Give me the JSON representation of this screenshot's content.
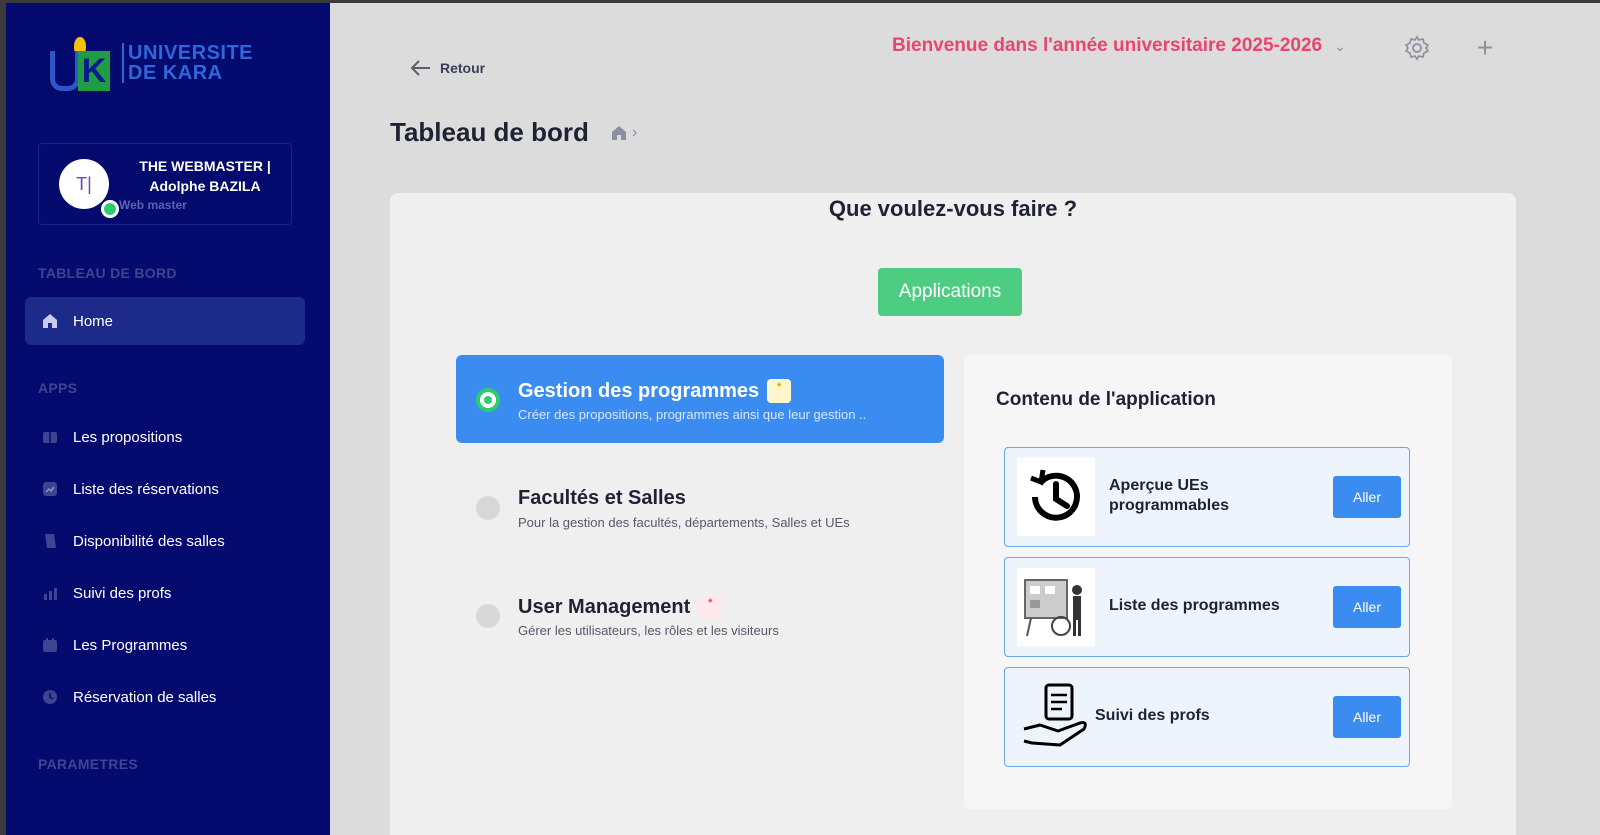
{
  "logo": {
    "letters_u": "U",
    "letters_k": "K",
    "line1": "UNIVERSITE",
    "line2": "DE KARA"
  },
  "profile": {
    "initials": "T|",
    "name": "THE WEBMASTER | Adolphe BAZILA",
    "role": "Web master"
  },
  "sidebar": {
    "section_dashboard": "TABLEAU DE BORD",
    "home": "Home",
    "section_apps": "APPS",
    "items": [
      {
        "label": "Les propositions",
        "icon": "book-icon"
      },
      {
        "label": "Liste des réservations",
        "icon": "chart-icon"
      },
      {
        "label": "Disponibilité des salles",
        "icon": "scroll-icon"
      },
      {
        "label": "Suivi des profs",
        "icon": "stats-icon"
      },
      {
        "label": "Les Programmes",
        "icon": "calendar-icon"
      },
      {
        "label": "Réservation de salles",
        "icon": "clock-icon"
      }
    ],
    "section_params": "PARAMETRES"
  },
  "header": {
    "back": "Retour",
    "welcome": "Bienvenue dans l'année universitaire 2025-2026",
    "page_title": "Tableau de bord"
  },
  "main": {
    "question": "Que voulez-vous faire ?",
    "apps_button": "Applications",
    "options": [
      {
        "title": "Gestion des programmes",
        "desc": "Créer des propositions, programmes ainsi que leur gestion ..",
        "badge": "*"
      },
      {
        "title": "Facultés et Salles",
        "desc": "Pour la gestion des facultés, départements, Salles et UEs"
      },
      {
        "title": "User Management",
        "desc": "Gérer les utilisateurs, les rôles et les visiteurs",
        "badge": "*"
      }
    ],
    "content_title": "Contenu de l'application",
    "content_items": [
      {
        "name": "Aperçue UEs programmables",
        "button": "Aller"
      },
      {
        "name": "Liste des programmes",
        "button": "Aller"
      },
      {
        "name": "Suivi des profs",
        "button": "Aller"
      }
    ]
  },
  "colors": {
    "sidebar": "#050a6e",
    "accent_blue": "#3b8cf1",
    "green": "#4ccd82",
    "welcome": "#e8456f"
  }
}
